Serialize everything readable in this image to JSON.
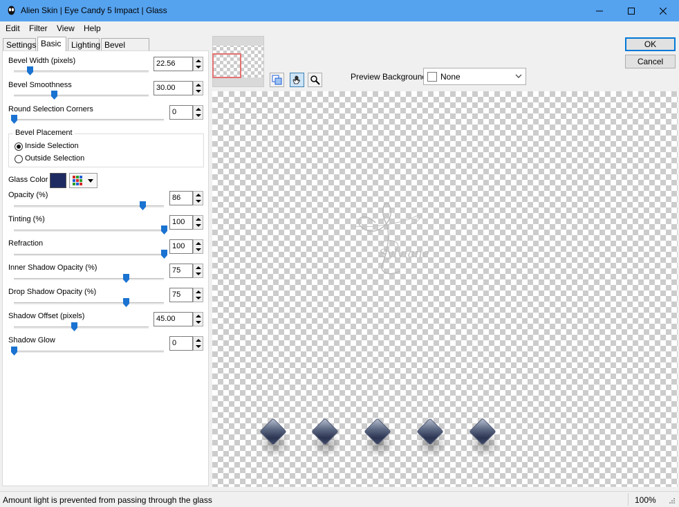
{
  "window": {
    "title": "Alien Skin | Eye Candy 5 Impact | Glass",
    "titlebar_color": "#55a2ef"
  },
  "menu": {
    "items": [
      "Edit",
      "Filter",
      "View",
      "Help"
    ]
  },
  "tabs": [
    "Settings",
    "Basic",
    "Lighting",
    "Bevel Profile"
  ],
  "basic": {
    "bevel_width": {
      "label": "Bevel Width (pixels)",
      "value": "22.56",
      "level": 0.12
    },
    "bevel_smoothness": {
      "label": "Bevel Smoothness",
      "value": "30.00",
      "level": 0.3
    },
    "round_corners": {
      "label": "Round Selection Corners",
      "value": "0",
      "level": 0.0
    },
    "bevel_placement": {
      "title": "Bevel Placement",
      "inside": "Inside Selection",
      "outside": "Outside Selection",
      "selected": "inside"
    },
    "glass_color": {
      "label": "Glass Color",
      "color": "#1e2b63"
    },
    "opacity": {
      "label": "Opacity (%)",
      "value": "86",
      "level": 0.86
    },
    "tinting": {
      "label": "Tinting (%)",
      "value": "100",
      "level": 1.0
    },
    "refraction": {
      "label": "Refraction",
      "value": "100",
      "level": 1.0
    },
    "inner_shadow_opacity": {
      "label": "Inner Shadow Opacity (%)",
      "value": "75",
      "level": 0.75
    },
    "drop_shadow_opacity": {
      "label": "Drop Shadow Opacity (%)",
      "value": "75",
      "level": 0.75
    },
    "shadow_offset": {
      "label": "Shadow Offset (pixels)",
      "value": "45.00",
      "level": 0.45
    },
    "shadow_glow": {
      "label": "Shadow Glow",
      "value": "0",
      "level": 0.0
    }
  },
  "preview": {
    "background_label": "Preview Background:",
    "background_value": "None",
    "watermark_text": "Sylviane"
  },
  "buttons": {
    "ok": "OK",
    "cancel": "Cancel"
  },
  "status": {
    "text": "Amount light is prevented from passing through the glass",
    "zoom": "100%"
  },
  "colors": {
    "accent": "#0078d7",
    "thumb": "#1a73d1",
    "gem_dark": "#2b3552"
  }
}
